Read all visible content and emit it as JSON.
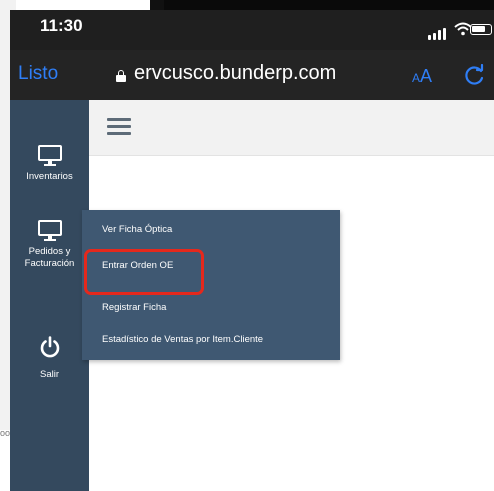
{
  "status_bar": {
    "time": "11:30",
    "signal_icon": "signal-bars-icon",
    "wifi_icon": "wifi-icon",
    "battery_icon": "battery-icon"
  },
  "url_bar": {
    "done_label": "Listo",
    "url": "ervcusco.bunderp.com",
    "text_size_small": "A",
    "text_size_big": "A",
    "reload_icon": "reload-icon",
    "lock_icon": "lock-icon",
    "accent_color": "#2f7ef6"
  },
  "header": {
    "menu_icon": "hamburger-menu-icon"
  },
  "sidebar": {
    "background_color": "#34495e",
    "items": [
      {
        "label": "Inventarios",
        "icon": "monitor-icon"
      },
      {
        "label_line1": "Pedidos y",
        "label_line2": "Facturación",
        "icon": "monitor-icon"
      },
      {
        "label": "Salir",
        "icon": "power-icon"
      }
    ]
  },
  "submenu": {
    "background_color": "#3f5872",
    "items": [
      {
        "label": "Ver Ficha Óptica"
      },
      {
        "label": "Entrar Orden OE",
        "highlighted": true
      },
      {
        "label": "Registrar Ficha"
      },
      {
        "label": "Estadístico de Ventas por Item.Cliente"
      }
    ],
    "highlight_color": "#e5281c"
  },
  "background": {
    "fragment_text": "oo"
  }
}
